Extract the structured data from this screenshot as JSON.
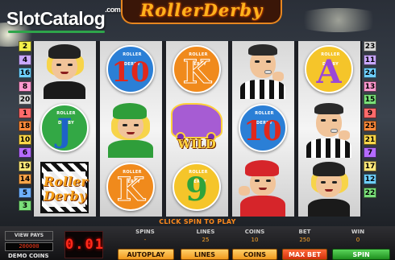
{
  "watermark": {
    "brand": "SlotCatalog",
    "suffix": ".com"
  },
  "game": {
    "logo": "RollerDerby"
  },
  "paylines": {
    "left": [
      {
        "n": "2",
        "color": "#f4f04a"
      },
      {
        "n": "4",
        "color": "#c9a8ff"
      },
      {
        "n": "16",
        "color": "#6fd0ff"
      },
      {
        "n": "8",
        "color": "#ff9ad0"
      },
      {
        "n": "20",
        "color": "#d8d8d8"
      },
      {
        "n": "1",
        "color": "#ff6a6a"
      },
      {
        "n": "18",
        "color": "#ff8a3a"
      },
      {
        "n": "10",
        "color": "#ffd84a"
      },
      {
        "n": "6",
        "color": "#b56bff"
      },
      {
        "n": "19",
        "color": "#ffe97a"
      },
      {
        "n": "14",
        "color": "#ffa64a"
      },
      {
        "n": "5",
        "color": "#6fb0ff"
      },
      {
        "n": "3",
        "color": "#7ae07a"
      }
    ],
    "right": [
      {
        "n": "23",
        "color": "#d8d8d8"
      },
      {
        "n": "11",
        "color": "#c9a8ff"
      },
      {
        "n": "24",
        "color": "#6fd0ff"
      },
      {
        "n": "13",
        "color": "#ff9ad0"
      },
      {
        "n": "15",
        "color": "#7ae07a"
      },
      {
        "n": "9",
        "color": "#ff6a6a"
      },
      {
        "n": "25",
        "color": "#ff8a3a"
      },
      {
        "n": "21",
        "color": "#ffd84a"
      },
      {
        "n": "7",
        "color": "#b56bff"
      },
      {
        "n": "17",
        "color": "#ffe97a"
      },
      {
        "n": "12",
        "color": "#6fd0ff"
      },
      {
        "n": "22",
        "color": "#7ae07a"
      }
    ]
  },
  "reels": {
    "r1": [
      "girl-black-helmet",
      "J",
      "scatter"
    ],
    "r2": [
      "10",
      "girl-green-helmet",
      "K"
    ],
    "r3": [
      "K",
      "wild-skate",
      "9"
    ],
    "r4": [
      "referee",
      "10",
      "girl-red-helmet"
    ],
    "r5": [
      "A",
      "referee",
      "girl-black-helmet"
    ]
  },
  "symbols": {
    "ball_band": "ROLLER DERBY",
    "scatter_text": "Roller Derby",
    "wild_text": "WILD",
    "ten": "10",
    "jack": "J",
    "king": "K",
    "nine": "9",
    "ace": "A"
  },
  "colors": {
    "ball_blue": "#2b7fd6",
    "ball_orange": "#f08a1c",
    "ball_green": "#33a845",
    "ball_purple": "#8a4fc9",
    "glyph_red": "#e0281c",
    "glyph_orange": "#f08a1c",
    "glyph_blue": "#1e63c9",
    "glyph_green": "#2fa33b",
    "glyph_purple": "#9b47d6"
  },
  "message": "CLICK SPIN TO PLAY",
  "stats": {
    "spins": {
      "label": "SPINS",
      "value": "-"
    },
    "lines": {
      "label": "LINES",
      "value": "25"
    },
    "coins": {
      "label": "COINS",
      "value": "10"
    },
    "bet": {
      "label": "BET",
      "value": "250"
    },
    "win": {
      "label": "WIN",
      "value": "0"
    }
  },
  "buttons": {
    "autoplay": "AUTOPLAY",
    "lines": "LINES",
    "coins": "COINS",
    "maxbet": "MAX BET",
    "spin": "SPIN"
  },
  "account": {
    "view_pays": "VIEW PAYS",
    "credits": "200000",
    "demo": "DEMO COINS",
    "led": "0.01"
  }
}
